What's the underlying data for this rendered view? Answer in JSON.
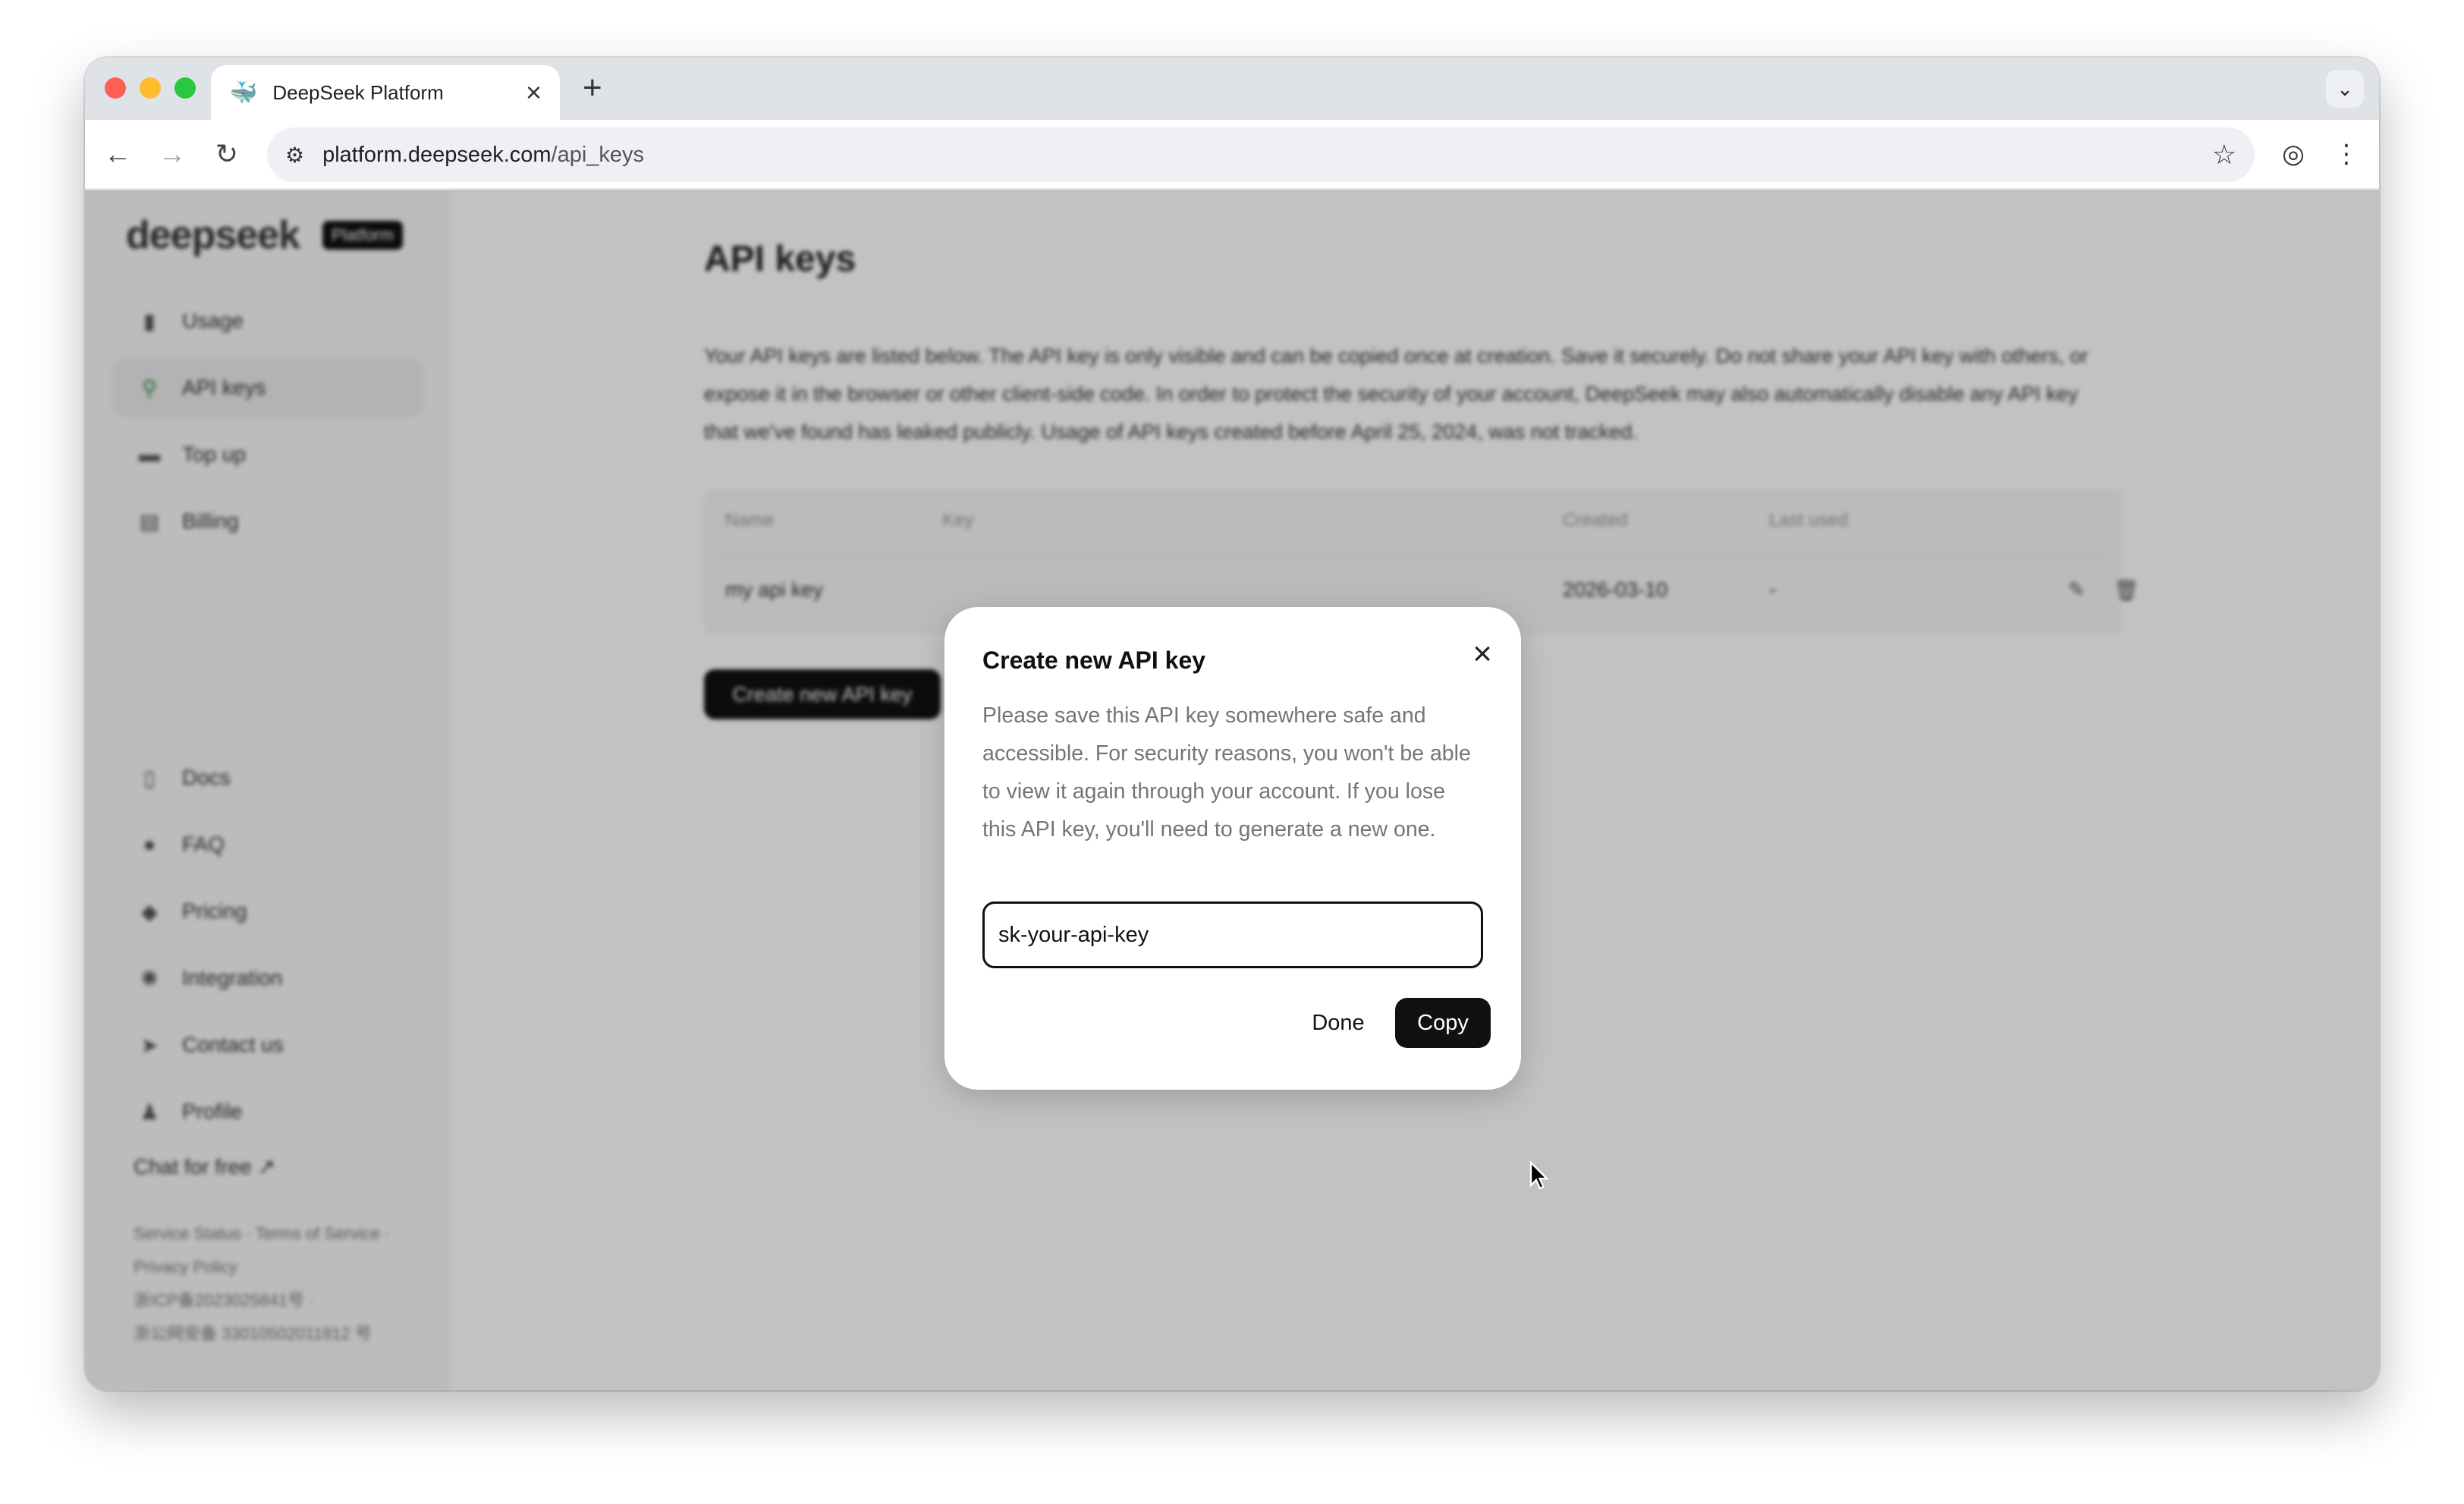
{
  "browser": {
    "tab_title": "DeepSeek Platform",
    "url_host": "platform.deepseek.com",
    "url_path": "/api_keys"
  },
  "sidebar": {
    "logo": "deepseek",
    "badge": "Platform",
    "items": [
      {
        "label": "Usage",
        "icon": "bar-chart-icon"
      },
      {
        "label": "API keys",
        "icon": "search-icon",
        "active": true
      },
      {
        "label": "Top up",
        "icon": "card-icon"
      },
      {
        "label": "Billing",
        "icon": "wallet-icon"
      }
    ],
    "bottom_items": [
      {
        "label": "Docs",
        "icon": "doc-icon"
      },
      {
        "label": "FAQ",
        "icon": "help-icon"
      },
      {
        "label": "Pricing",
        "icon": "tag-icon"
      },
      {
        "label": "Integration",
        "icon": "integration-icon"
      },
      {
        "label": "Contact us",
        "icon": "send-icon"
      },
      {
        "label": "Profile",
        "icon": "user-icon"
      }
    ],
    "chat_link": "Chat for free ↗",
    "footer_links": "Service Status · Terms of Service · Privacy Policy",
    "footer_icp": "浙ICP备2023025841号 ·",
    "footer_police": "浙公网安备 33010502011812 号"
  },
  "main": {
    "title": "API keys",
    "description": "Your API keys are listed below. The API key is only visible and can be copied once at creation. Save it securely. Do not share your API key with others, or expose it in the browser or other client-side code. In order to protect the security of your account, DeepSeek may also automatically disable any API key that we've found has leaked publicly. Usage of API keys created before April 25, 2024, was not tracked.",
    "table": {
      "headers": {
        "name": "Name",
        "key": "Key",
        "created": "Created",
        "last_used": "Last used"
      },
      "rows": [
        {
          "name": "my api key",
          "key": "",
          "created": "2026-03-10",
          "last_used": "-"
        }
      ]
    },
    "create_button": "Create new API key"
  },
  "modal": {
    "title": "Create new API key",
    "body": "Please save this API key somewhere safe and accessible. For security reasons, you won't be able to view it again through your account. If you lose this API key, you'll need to generate a new one.",
    "key_value": "sk-your-api-key",
    "done_label": "Done",
    "copy_label": "Copy"
  }
}
